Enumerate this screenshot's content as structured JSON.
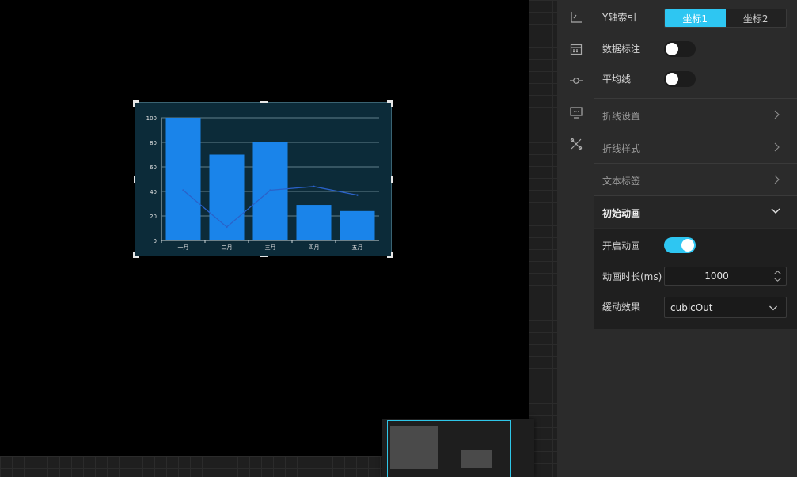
{
  "panel": {
    "y_axis_index": {
      "label": "Y轴索引",
      "options": [
        "坐标1",
        "坐标2"
      ],
      "selected": "坐标1"
    },
    "data_label": {
      "label": "数据标注",
      "enabled": false
    },
    "average_line": {
      "label": "平均线",
      "enabled": false
    },
    "sections": [
      {
        "label": "折线设置",
        "expanded": false
      },
      {
        "label": "折线样式",
        "expanded": false
      },
      {
        "label": "文本标签",
        "expanded": false
      },
      {
        "label": "初始动画",
        "expanded": true
      }
    ],
    "animation": {
      "enable_label": "开启动画",
      "enabled": true,
      "duration_label": "动画时长(ms)",
      "duration_value": "1000",
      "easing_label": "缓动效果",
      "easing_value": "cubicOut"
    }
  },
  "icons": [
    "axis-icon",
    "calendar-icon",
    "line-node-icon",
    "monitor-icon",
    "tools-icon"
  ],
  "colors": {
    "accent": "#2ec6f2",
    "bar": "#1a84ea",
    "line": "#2a62c9",
    "chart_bg": "#0c2b39"
  },
  "chart_data": {
    "type": "bar",
    "categories": [
      "一月",
      "二月",
      "三月",
      "四月",
      "五月"
    ],
    "series": [
      {
        "type": "bar",
        "values": [
          100,
          70,
          80,
          29,
          24
        ]
      },
      {
        "type": "line",
        "values": [
          41,
          11,
          41,
          44,
          37
        ]
      }
    ],
    "yticks": [
      "0",
      "20",
      "40",
      "60",
      "80",
      "100"
    ],
    "ylim": [
      0,
      100
    ],
    "grid": true,
    "legend": "none"
  }
}
